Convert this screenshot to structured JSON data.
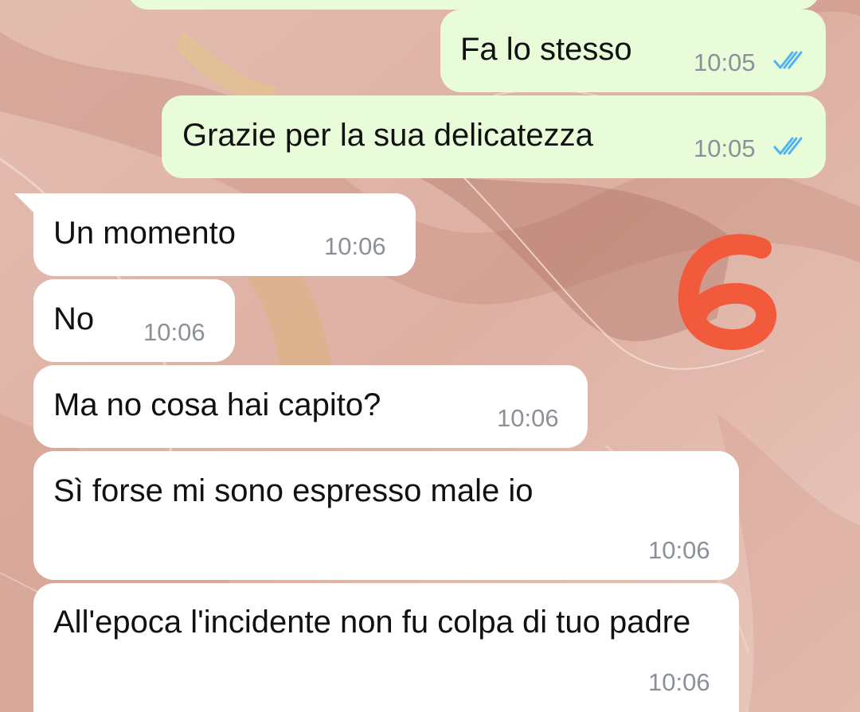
{
  "conversation": {
    "messages": [
      {
        "direction": "outgoing",
        "text": "Fa lo stesso",
        "time": "10:05",
        "status_icon": "double-check-read-icon"
      },
      {
        "direction": "outgoing",
        "text": "Grazie per la sua delicatezza",
        "time": "10:05",
        "status_icon": "double-check-read-icon"
      },
      {
        "direction": "incoming",
        "text": "Un momento",
        "time": "10:06"
      },
      {
        "direction": "incoming",
        "text": "No",
        "time": "10:06"
      },
      {
        "direction": "incoming",
        "text": "Ma no cosa hai capito?",
        "time": "10:06"
      },
      {
        "direction": "incoming",
        "text": "Sì forse mi sono espresso male io",
        "time": "10:06"
      },
      {
        "direction": "incoming",
        "text": "All'epoca l'incidente non fu colpa di tuo padre",
        "time": "10:06"
      }
    ]
  },
  "annotation": {
    "text": "6",
    "color": "#f25a3c"
  },
  "colors": {
    "outgoing_bubble": "#e9fcd9",
    "incoming_bubble": "#ffffff",
    "read_ticks": "#4fb3f0",
    "timestamp": "#8c9098"
  }
}
